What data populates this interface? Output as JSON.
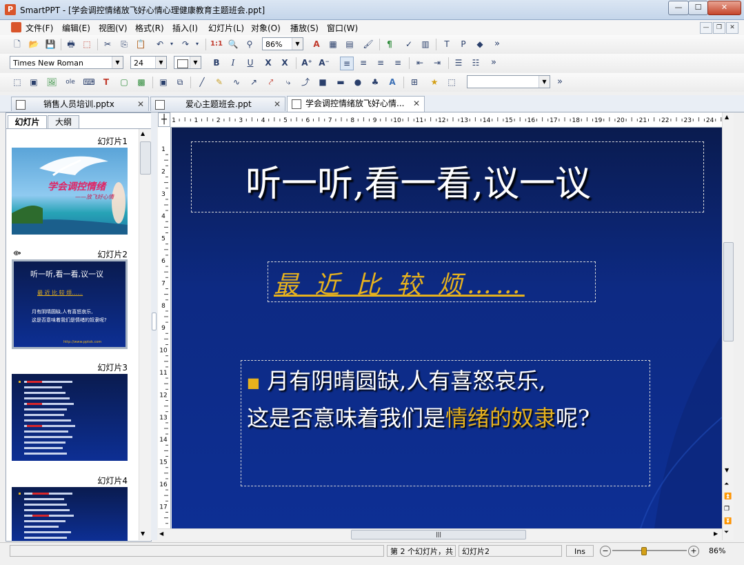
{
  "window": {
    "app_name": "SmartPPT",
    "title": "SmartPPT - [学会调控情绪放飞好心情心理健康教育主题班会.ppt]",
    "controls": [
      "minimize",
      "maximize",
      "close"
    ]
  },
  "menu": [
    "文件(F)",
    "编辑(E)",
    "视图(V)",
    "格式(R)",
    "插入(I)",
    "幻灯片(L)",
    "对象(O)",
    "播放(S)",
    "窗口(W)"
  ],
  "toolbar_standard": {
    "zoom_value": "86%",
    "more": "»"
  },
  "toolbar_format": {
    "font_name": "Times New Roman",
    "font_size": "24",
    "more": "»"
  },
  "toolbar_drawing": {
    "shape_combo_value": "",
    "more": "»"
  },
  "tabs": [
    {
      "label": "销售人员培训.pptx",
      "active": false
    },
    {
      "label": "爱心主题班会.ppt",
      "active": false
    },
    {
      "label": "学会调控情绪放飞好心情...",
      "active": true
    }
  ],
  "left_panel": {
    "tab_slides": "幻灯片",
    "tab_outline": "大纲",
    "thumbnails": [
      {
        "label": "幻灯片1",
        "title": "学会调控情绪",
        "subtitle": "——放飞好心情"
      },
      {
        "label": "幻灯片2",
        "title": "听一听,看一看,议一议",
        "subtitle": "最 近 比 较 烦……",
        "lines": [
          "月有阴晴圆缺,人有喜怒哀乐,",
          "这是否意味着我们是情绪的奴隶呢?"
        ],
        "footer": "http://www.pptok.com"
      },
      {
        "label": "幻灯片3"
      },
      {
        "label": "幻灯片4"
      }
    ]
  },
  "ruler": {
    "h_ticks": [
      "1",
      "1",
      "2",
      "3",
      "4",
      "5",
      "6",
      "7",
      "8",
      "9",
      "10",
      "11",
      "12",
      "13",
      "14",
      "15",
      "16",
      "17",
      "18",
      "19",
      "20",
      "21",
      "22",
      "23",
      "24"
    ],
    "v_ticks": [
      "1",
      "2",
      "3",
      "4",
      "5",
      "6",
      "7",
      "8",
      "9",
      "10",
      "11",
      "12",
      "13",
      "14",
      "15",
      "16",
      "17"
    ]
  },
  "slide": {
    "title": "听一听,看一看,议一议",
    "subtitle": "最 近 比 较 烦……",
    "bullet": "■",
    "line1": "月有阴晴圆缺,人有喜怒哀乐,",
    "line2_pre": "这是否意味着我们是",
    "line2_highlight": "情绪的奴隶",
    "line2_post": "呢?"
  },
  "statusbar": {
    "slide_info": "第 2 个幻灯片，共",
    "slide_name": "幻灯片2",
    "ins": "Ins",
    "zoom": "86%",
    "zoom_fraction": 0.43
  },
  "colors": {
    "slide_bg": "#0d2a83",
    "highlight": "#e7b21d"
  }
}
